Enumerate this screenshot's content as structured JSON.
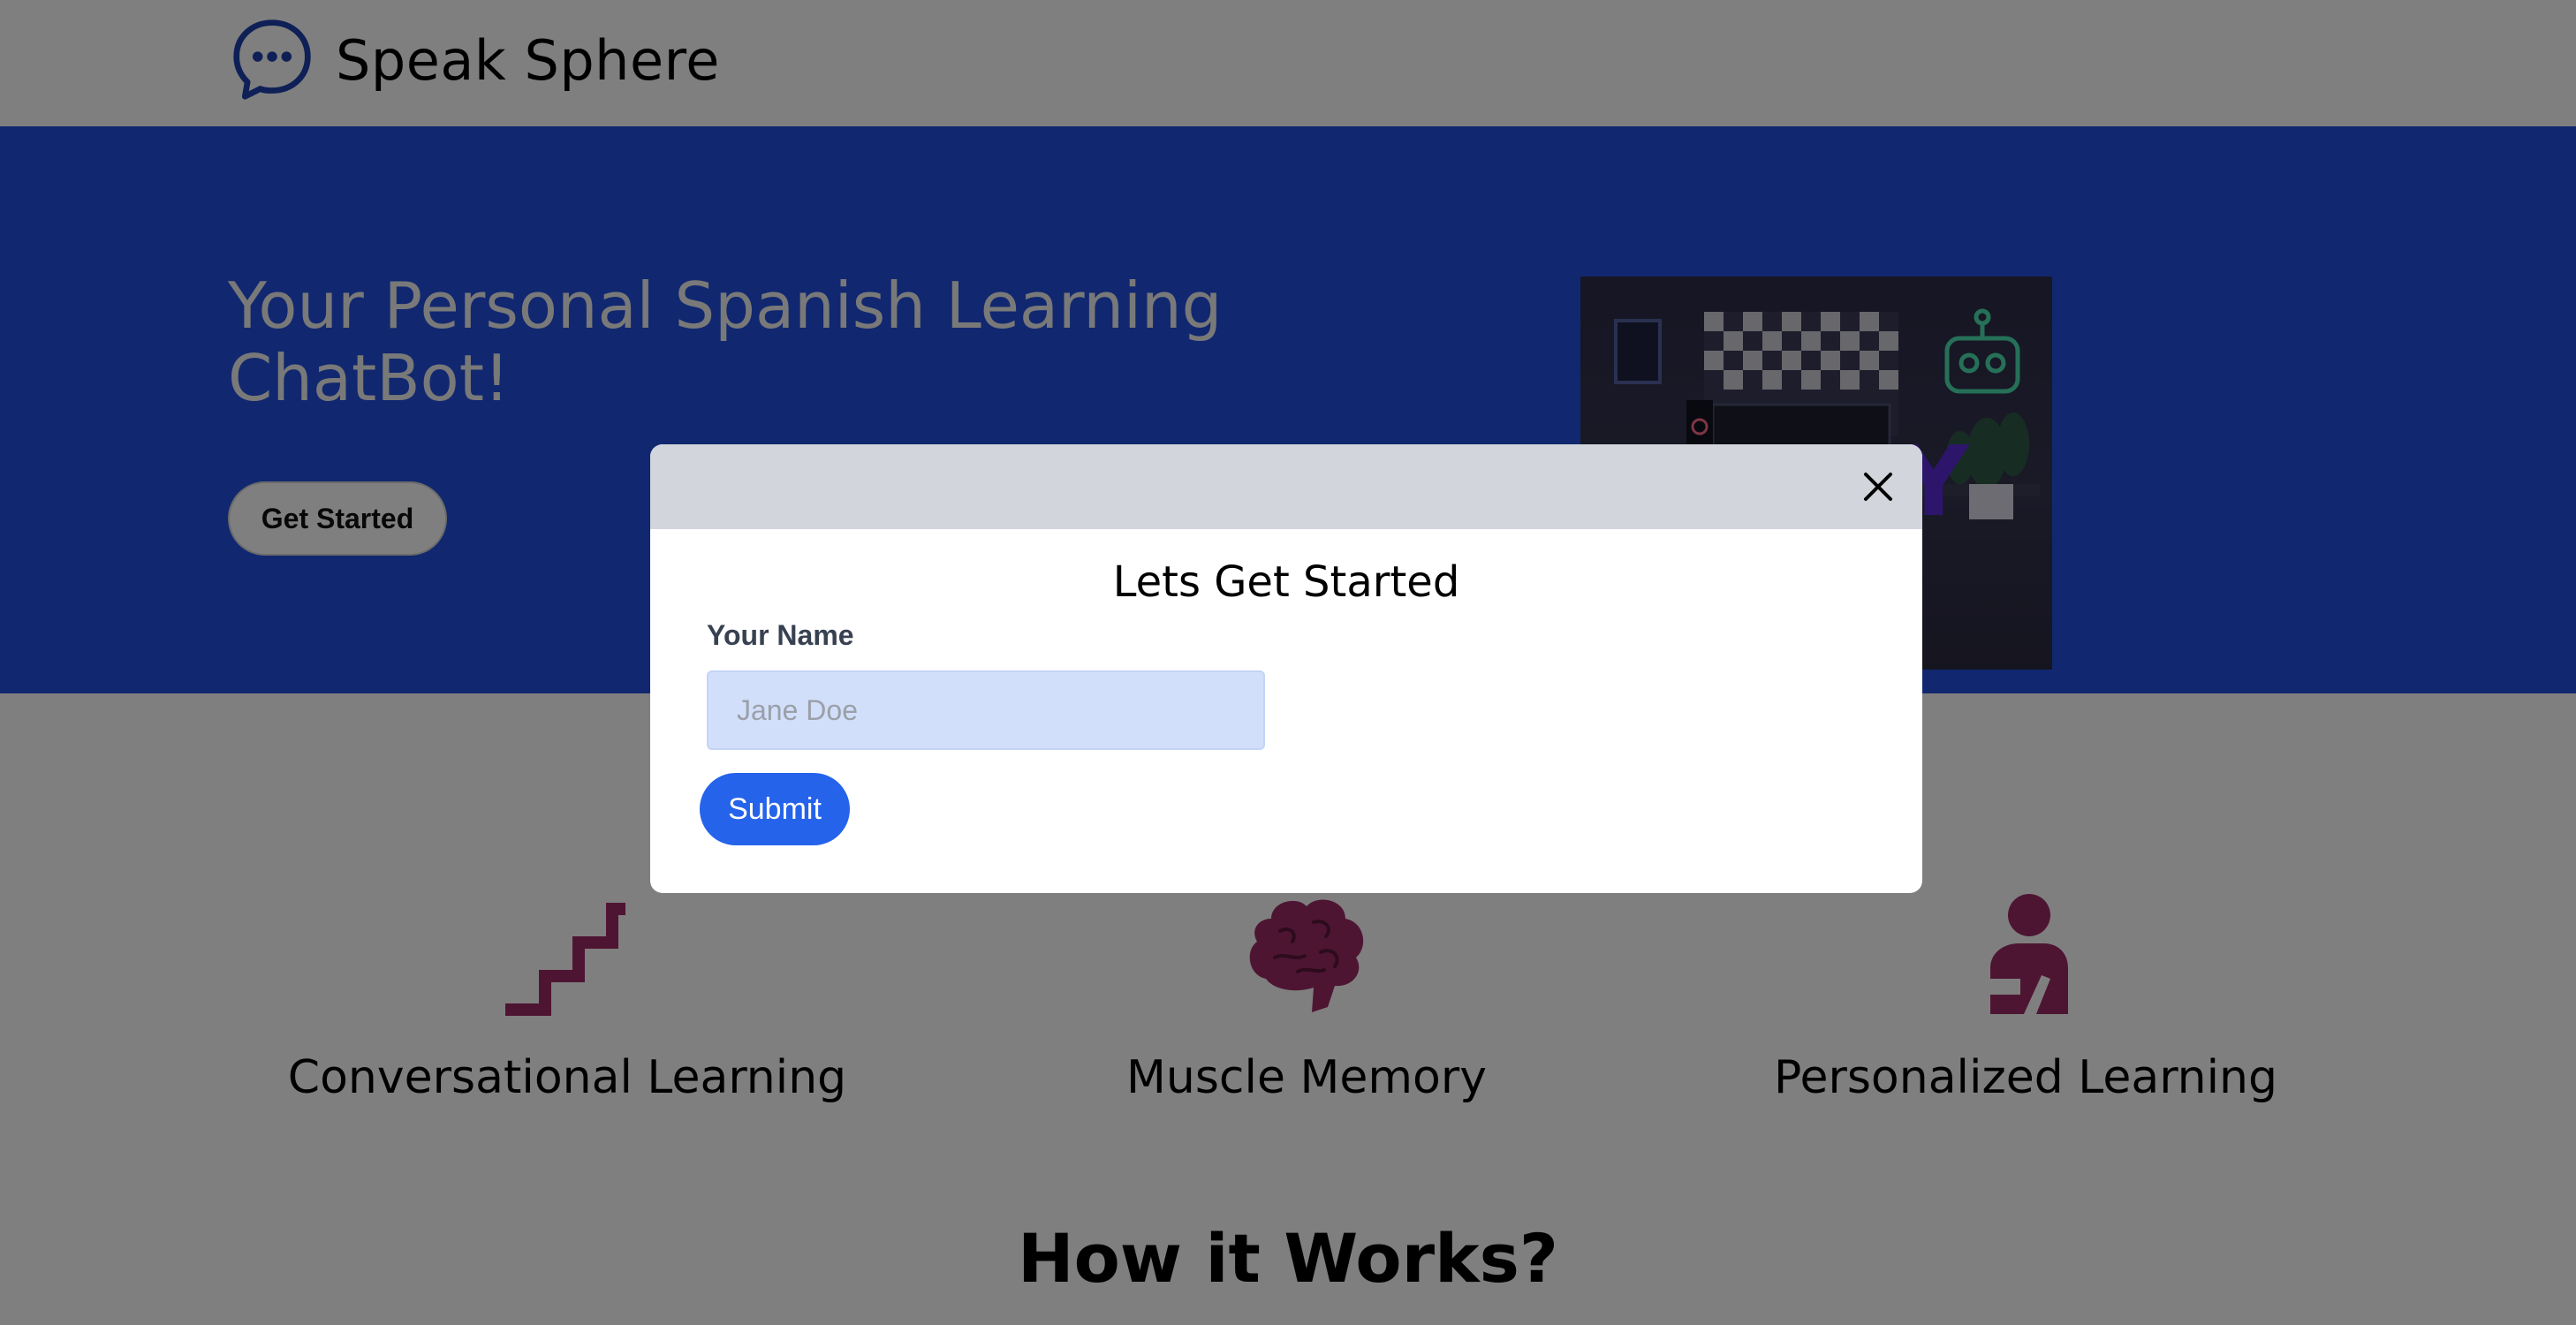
{
  "navbar": {
    "brand_name": "Speak Sphere",
    "logo_icon": "chat-bubble-icon"
  },
  "hero": {
    "title": "Your Personal Spanish Learning ChatBot!",
    "cta_label": "Get Started",
    "image_icon": "robot-studio-illustration"
  },
  "features": [
    {
      "label": "Conversational Learning",
      "icon": "stairs-icon"
    },
    {
      "label": "Muscle Memory",
      "icon": "brain-icon"
    },
    {
      "label": "Personalized Learning",
      "icon": "person-icon"
    }
  ],
  "how_it_works": {
    "title": "How it Works?"
  },
  "modal": {
    "title": "Lets Get Started",
    "name_label": "Your Name",
    "name_placeholder": "Jane Doe",
    "name_value": "",
    "submit_label": "Submit",
    "close_icon": "close-icon"
  },
  "colors": {
    "hero_bg": "#2350e0",
    "accent_icon": "#9c2a67",
    "primary_button": "#2563eb",
    "overlay": "rgba(0,0,0,0.5)"
  }
}
